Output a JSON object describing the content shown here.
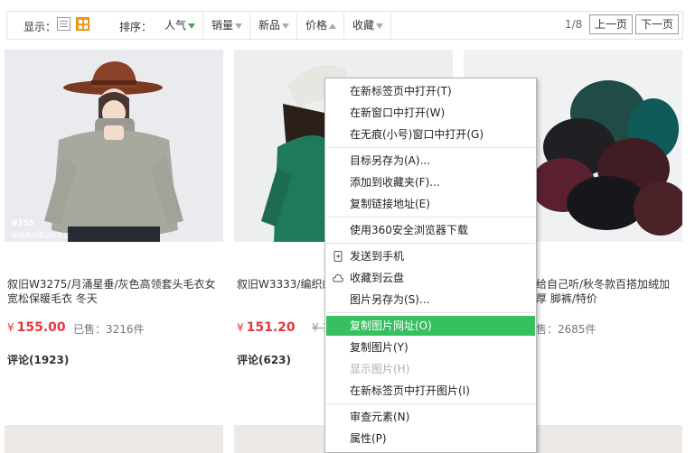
{
  "toolbar": {
    "display_label": "显示：",
    "sort_label": "排序：",
    "sort_items": [
      {
        "label": "人气"
      },
      {
        "label": "销量"
      },
      {
        "label": "新品"
      },
      {
        "label": "价格"
      },
      {
        "label": "收藏"
      }
    ],
    "page_info": "1/8",
    "prev_label": "上一页",
    "next_label": "下一页"
  },
  "products": [
    {
      "title": "叙旧W3275/月涌星垂/灰色高领套头毛衣女宽松保暖毛衣 冬天",
      "currency": "¥",
      "price": "155.00",
      "sold": "已售：3216件",
      "reviews": "评论(1923)",
      "image_price_tag": "¥155",
      "image_caption": "如偶遇也请记得毛衣"
    },
    {
      "title": "叙旧W3333/编织的 打底毛衣 秋冬",
      "currency": "¥",
      "price": "151.20",
      "old_price": "16",
      "reviews": "评论(623)"
    },
    {
      "title": "给自己听/秋冬款百搭加绒加厚 脚裤/特价",
      "sold": "售：2685件"
    }
  ],
  "context_menu": {
    "items": [
      {
        "label": "在新标签页中打开(T)"
      },
      {
        "label": "在新窗口中打开(W)"
      },
      {
        "label": "在无痕(小号)窗口中打开(G)"
      },
      {
        "label": "目标另存为(A)..."
      },
      {
        "label": "添加到收藏夹(F)..."
      },
      {
        "label": "复制链接地址(E)"
      },
      {
        "label": "使用360安全浏览器下载"
      },
      {
        "label": "发送到手机",
        "icon": "phone-icon"
      },
      {
        "label": "收藏到云盘",
        "icon": "cloud-icon"
      },
      {
        "label": "图片另存为(S)..."
      },
      {
        "label": "复制图片网址(O)"
      },
      {
        "label": "复制图片(Y)"
      },
      {
        "label": "显示图片(H)"
      },
      {
        "label": "在新标签页中打开图片(I)"
      },
      {
        "label": "审查元素(N)"
      },
      {
        "label": "属性(P)"
      }
    ]
  },
  "colors": {
    "price": "#e4393c",
    "menu_highlight": "#37c05f",
    "grid_icon": "#f39a1e"
  }
}
